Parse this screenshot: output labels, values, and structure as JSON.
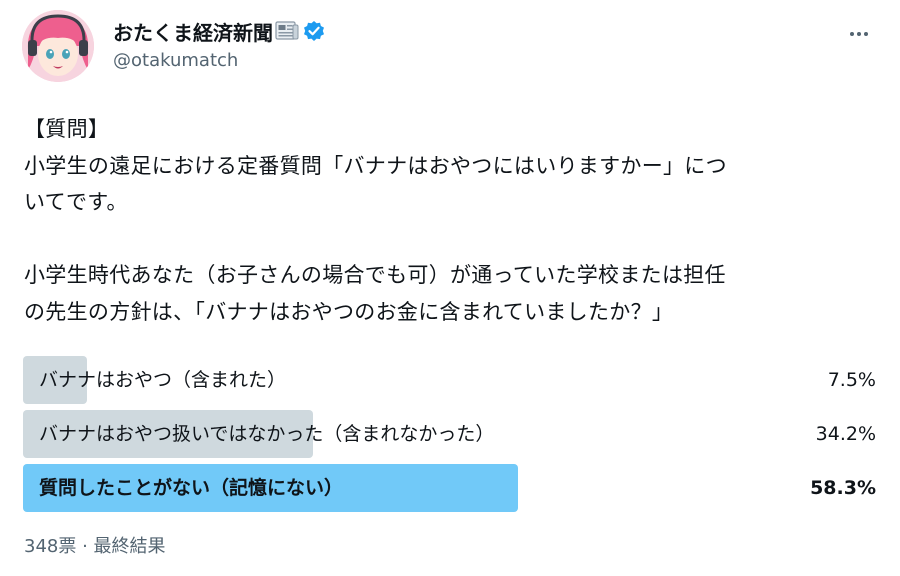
{
  "author": {
    "display_name": "おたくま経済新聞",
    "handle": "@otakumatch",
    "name_icon": "newspaper-icon",
    "verified_icon": "verified-badge-icon",
    "verified_color": "#1d9bf0"
  },
  "more_icon": "more-options-icon",
  "tweet": {
    "text": "【質問】\n小学生の遠足における定番質問「バナナはおやつにはいりますかー」につ\nいてです。\n\n小学生時代あなた（お子さんの場合でも可）が通っていた学校または担任\nの先生の方針は、「バナナはおやつのお金に含まれていましたか？」"
  },
  "poll": {
    "options": [
      {
        "label": "バナナはおやつ（含まれた）",
        "percent_text": "7.5%",
        "percent": 7.5,
        "winner": false
      },
      {
        "label": "バナナはおやつ扱いではなかった（含まれなかった）",
        "percent_text": "34.2%",
        "percent": 34.2,
        "winner": false
      },
      {
        "label": "質問したことがない（記憶にない）",
        "percent_text": "58.3%",
        "percent": 58.3,
        "winner": true
      }
    ],
    "footer": "348票 · 最終結果",
    "bar_color": "#cfd9de",
    "winner_color": "#71c9f8"
  }
}
